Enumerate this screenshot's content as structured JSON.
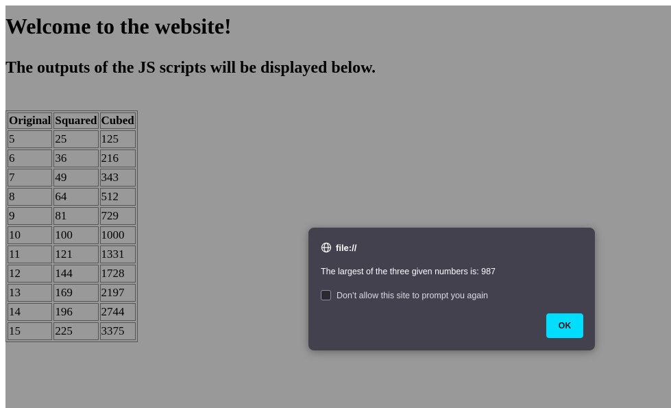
{
  "page": {
    "heading1": "Welcome to the website!",
    "heading2": "The outputs of the JS scripts will be displayed below."
  },
  "table": {
    "headers": [
      "Original",
      "Squared",
      "Cubed"
    ],
    "rows": [
      [
        "5",
        "25",
        "125"
      ],
      [
        "6",
        "36",
        "216"
      ],
      [
        "7",
        "49",
        "343"
      ],
      [
        "8",
        "64",
        "512"
      ],
      [
        "9",
        "81",
        "729"
      ],
      [
        "10",
        "100",
        "1000"
      ],
      [
        "11",
        "121",
        "1331"
      ],
      [
        "12",
        "144",
        "1728"
      ],
      [
        "13",
        "169",
        "2197"
      ],
      [
        "14",
        "196",
        "2744"
      ],
      [
        "15",
        "225",
        "3375"
      ]
    ]
  },
  "dialog": {
    "origin": "file://",
    "origin_icon": "globe-icon",
    "message": "The largest of the three given numbers is: 987",
    "checkbox_label": "Don’t allow this site to prompt you again",
    "checkbox_checked": false,
    "ok_label": "OK",
    "colors": {
      "background": "#42414d",
      "ok_button": "#00ddff",
      "overlay": "#999999"
    }
  }
}
